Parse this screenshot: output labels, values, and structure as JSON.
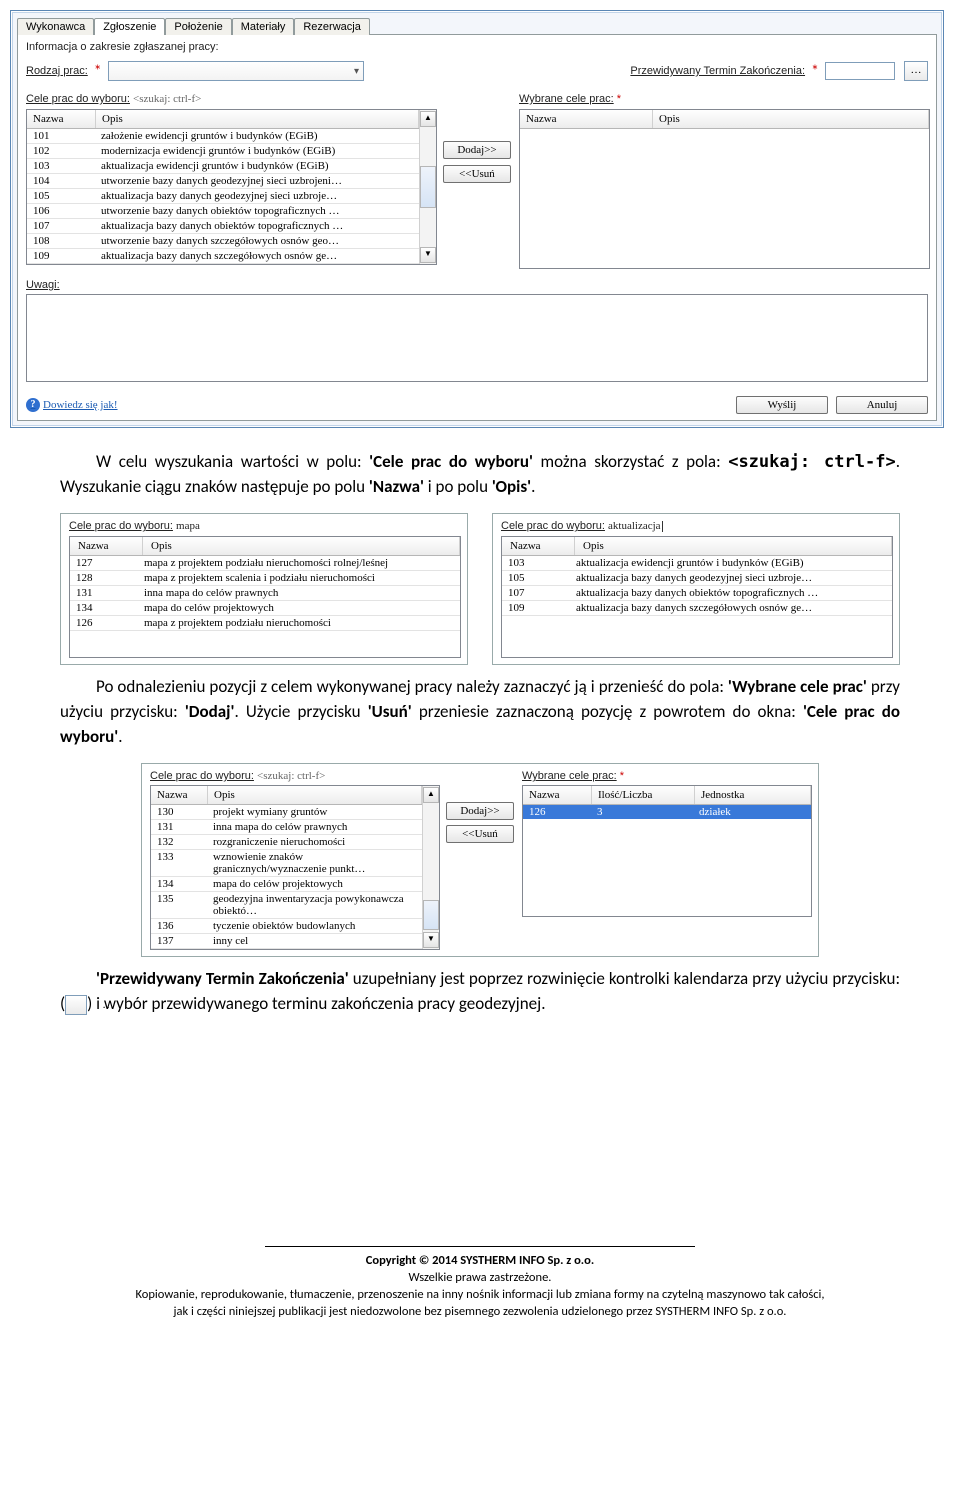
{
  "win1": {
    "tabs": [
      "Wykonawca",
      "Zgłoszenie",
      "Położenie",
      "Materiały",
      "Rezerwacja"
    ],
    "active_tab": "Zgłoszenie",
    "info_label": "Informacja o zakresie zgłaszanej pracy:",
    "rodzaj_label": "Rodzaj prac:",
    "termin_label": "Przewidywany Termin Zakończenia:",
    "termin_value": "",
    "cele_left_label": "Cele prac do wyboru:",
    "cele_search_hint": "<szukaj: ctrl-f>",
    "cele_right_label": "Wybrane cele prac:",
    "col_nazwa": "Nazwa",
    "col_opis": "Opis",
    "left_rows": [
      {
        "n": "101",
        "o": "założenie ewidencji gruntów i budynków (EGiB)"
      },
      {
        "n": "102",
        "o": "modernizacja ewidencji gruntów i budynków (EGiB)"
      },
      {
        "n": "103",
        "o": "aktualizacja ewidencji gruntów i budynków (EGiB)"
      },
      {
        "n": "104",
        "o": "utworzenie bazy danych geodezyjnej sieci uzbrojeni…"
      },
      {
        "n": "105",
        "o": "aktualizacja bazy danych geodezyjnej sieci uzbroje…"
      },
      {
        "n": "106",
        "o": "utworzenie bazy danych obiektów topograficznych …"
      },
      {
        "n": "107",
        "o": "aktualizacja bazy danych obiektów topograficznych …"
      },
      {
        "n": "108",
        "o": "utworzenie bazy danych szczegółowych osnów geo…"
      },
      {
        "n": "109",
        "o": "aktualizacja bazy danych szczegółowych osnów ge…"
      }
    ],
    "btn_dodaj": "Dodaj>>",
    "btn_usun": "<<Usuń",
    "uwagi_label": "Uwagi:",
    "help_link": "Dowiedz się jak!",
    "btn_wyslij": "Wyślij",
    "btn_anuluj": "Anuluj"
  },
  "para1_pre": "W celu wyszukania wartości w polu: ",
  "para1_b1": "'Cele prac do wyboru'",
  "para1_mid": " można skorzystać z pola: ",
  "para1_b2": "<szukaj: ctrl-f>",
  "para1_post": ". Wyszukanie ciągu znaków następuje po polu ",
  "para1_b3": "'Nazwa'",
  "para1_and": " i po polu ",
  "para1_b4": "'Opis'",
  "para1_end": ".",
  "shot2": {
    "left_label": "Cele prac do wyboru:",
    "left_search": "mapa",
    "right_label": "Cele prac do wyboru:",
    "right_search": "aktualizacja",
    "col_nazwa": "Nazwa",
    "col_opis": "Opis",
    "left_rows": [
      {
        "n": "127",
        "o": "mapa z projektem podziału nieruchomości rolnej/leśnej"
      },
      {
        "n": "128",
        "o": "mapa z projektem scalenia i podziału nieruchomości"
      },
      {
        "n": "131",
        "o": "inna mapa do celów prawnych"
      },
      {
        "n": "134",
        "o": "mapa do celów projektowych"
      },
      {
        "n": "126",
        "o": "mapa z projektem podziału nieruchomości"
      }
    ],
    "right_rows": [
      {
        "n": "103",
        "o": "aktualizacja ewidencji gruntów i budynków (EGiB)"
      },
      {
        "n": "105",
        "o": "aktualizacja bazy danych geodezyjnej sieci uzbroje…"
      },
      {
        "n": "107",
        "o": "aktualizacja bazy danych obiektów topograficznych …"
      },
      {
        "n": "109",
        "o": "aktualizacja bazy danych szczegółowych osnów ge…"
      }
    ]
  },
  "para2_pre": "Po odnalezieniu pozycji z celem wykonywanej pracy należy zaznaczyć ją i przenieść do pola: ",
  "para2_b1": "'Wybrane cele prac'",
  "para2_mid": " przy użyciu przycisku: ",
  "para2_b2": "'Dodaj'",
  "para2_mid2": ". Użycie przycisku ",
  "para2_b3": "'Usuń'",
  "para2_tail": " przeniesie zaznaczoną pozycję z powrotem do okna: ",
  "para2_b4": "'Cele prac do wyboru'",
  "para2_end": ".",
  "shot3": {
    "left_label": "Cele prac do wyboru:",
    "left_hint": "<szukaj: ctrl-f>",
    "right_label": "Wybrane cele prac:",
    "col_nazwa": "Nazwa",
    "col_opis": "Opis",
    "col_ilosc": "Ilość/Liczba",
    "col_jedn": "Jednostka",
    "left_rows": [
      {
        "n": "130",
        "o": "projekt wymiany gruntów"
      },
      {
        "n": "131",
        "o": "inna mapa do celów prawnych"
      },
      {
        "n": "132",
        "o": "rozgraniczenie nieruchomości"
      },
      {
        "n": "133",
        "o": "wznowienie znaków granicznych/wyznaczenie punkt…"
      },
      {
        "n": "134",
        "o": "mapa do celów projektowych"
      },
      {
        "n": "135",
        "o": "geodezyjna inwentaryzacja powykonawcza obiektó…"
      },
      {
        "n": "136",
        "o": "tyczenie obiektów budowlanych"
      },
      {
        "n": "137",
        "o": "inny cel"
      }
    ],
    "right_rows": [
      {
        "n": "126",
        "il": "3",
        "j": "działek"
      }
    ],
    "btn_dodaj": "Dodaj>>",
    "btn_usun": "<<Usuń"
  },
  "para3_b1": "'Przewidywany Termin Zakończenia'",
  "para3_mid": " uzupełniany jest poprzez rozwinięcie kontrolki kalendarza przy użyciu przycisku: (",
  "para3_icon": "…",
  "para3_tail": ") i wybór przewidywanego terminu zakończenia pracy geodezyjnej.",
  "footer": {
    "copyright": "Copyright © 2014 SYSTHERM INFO Sp. z o.o.",
    "rights": "Wszelkie prawa zastrzeżone.",
    "l1": "Kopiowanie, reprodukowanie, tłumaczenie, przenoszenie na inny nośnik informacji lub zmiana formy na czytelną maszynowo tak całości,",
    "l2": "jak i części niniejszej publikacji jest niedozwolone bez pisemnego zezwolenia udzielonego przez SYSTHERM INFO Sp. z o.o."
  }
}
